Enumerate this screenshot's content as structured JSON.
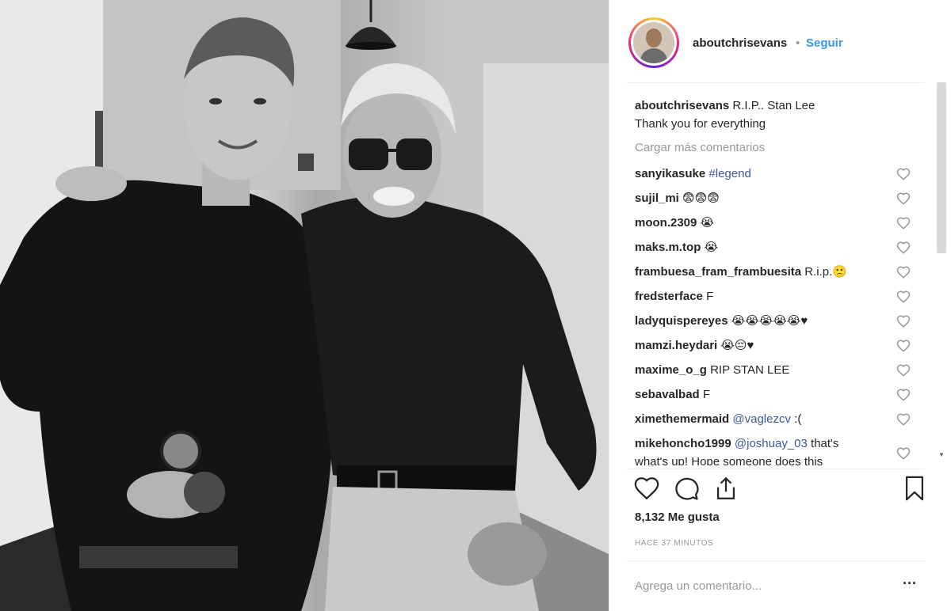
{
  "post": {
    "username": "aboutchrisevans",
    "dot": "•",
    "follow_label": "Seguir",
    "caption_user": "aboutchrisevans",
    "caption_line1": "R.I.P.. Stan Lee",
    "caption_line2": "Thank you for everything",
    "load_more": "Cargar más comentarios",
    "likes": "8,132 Me gusta",
    "time": "HACE 37 MINUTOS",
    "add_comment_placeholder": "Agrega un comentario...",
    "more_icon": "more-horizontal-icon"
  },
  "comments": [
    {
      "user": "sanyikasuke",
      "text": "",
      "mention": "#legend"
    },
    {
      "user": "sujil_mi",
      "text": "😨😨😨",
      "mention": ""
    },
    {
      "user": "moon.2309",
      "text": "😭",
      "mention": ""
    },
    {
      "user": "maks.m.top",
      "text": "😭",
      "mention": ""
    },
    {
      "user": "frambuesa_fram_frambuesita",
      "text": "R.i.p.🙁",
      "mention": ""
    },
    {
      "user": "fredsterface",
      "text": "F",
      "mention": ""
    },
    {
      "user": "ladyquispereyes",
      "text": "😭😭😭😭😭♥",
      "mention": ""
    },
    {
      "user": "mamzi.heydari",
      "text": "😭😔♥",
      "mention": ""
    },
    {
      "user": "maxime_o_g",
      "text": "RIP STAN LEE",
      "mention": ""
    },
    {
      "user": "sebavalbad",
      "text": "F",
      "mention": ""
    },
    {
      "user": "ximethemermaid",
      "text": "",
      "mention": "@vaglezcv",
      "after": ":("
    },
    {
      "user": "mikehoncho1999",
      "text": "",
      "mention": "@joshuay_03",
      "after": "that's",
      "line2": "what's up! Hope someone does this"
    }
  ],
  "icons": {
    "like": "heart-icon",
    "comment": "comment-icon",
    "share": "share-icon",
    "save": "bookmark-icon",
    "comment_like": "heart-icon"
  },
  "colors": {
    "link": "#3897f0",
    "mention": "#3b5998",
    "muted": "#999999",
    "text": "#262626"
  }
}
